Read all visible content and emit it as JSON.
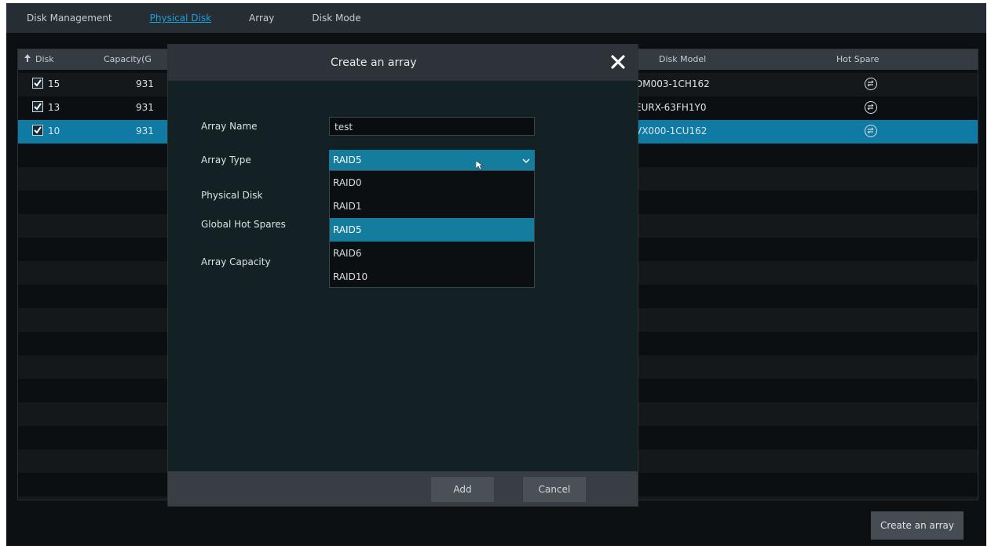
{
  "tabs": [
    {
      "label": "Disk Management",
      "active": false
    },
    {
      "label": "Physical Disk",
      "active": true
    },
    {
      "label": "Array",
      "active": false
    },
    {
      "label": "Disk Mode",
      "active": false
    }
  ],
  "table": {
    "headers": {
      "disk": "Disk",
      "capacity": "Capacity(G",
      "model": "Disk Model",
      "hot_spare": "Hot Spare"
    },
    "rows": [
      {
        "disk": "15",
        "capacity": "931",
        "model": "DM003-1CH162",
        "checked": true,
        "selected": false
      },
      {
        "disk": "13",
        "capacity": "931",
        "model": "EURX-63FH1Y0",
        "checked": true,
        "selected": false
      },
      {
        "disk": "10",
        "capacity": "931",
        "model": "VX000-1CU162",
        "checked": true,
        "selected": true
      }
    ]
  },
  "dialog": {
    "title": "Create an array",
    "fields": {
      "array_name_label": "Array Name",
      "array_name_value": "test",
      "array_type_label": "Array Type",
      "array_type_value": "RAID5",
      "physical_disk_label": "Physical Disk",
      "global_hot_spares_label": "Global Hot Spares",
      "array_capacity_label": "Array Capacity"
    },
    "array_type_options": [
      "RAID0",
      "RAID1",
      "RAID5",
      "RAID6",
      "RAID10"
    ],
    "selected_option": "RAID5",
    "add_label": "Add",
    "cancel_label": "Cancel"
  },
  "create_array_button": "Create an array",
  "colors": {
    "accent": "#147d9e",
    "active_tab": "#1ba0d8",
    "selected_row": "#0f7aa3"
  }
}
